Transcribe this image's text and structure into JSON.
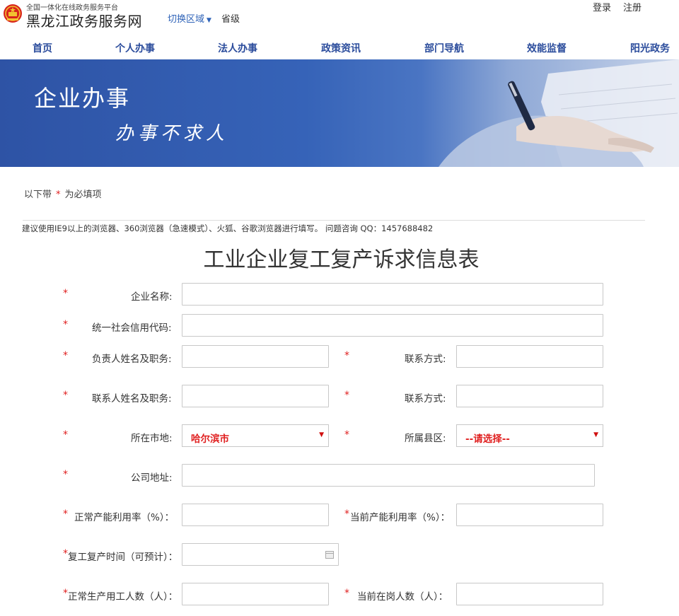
{
  "header": {
    "site_subtitle": "全国一体化在线政务服务平台",
    "site_title": "黑龙江政务服务网",
    "region_switch": "切换区域",
    "region_current": "省级",
    "login": "登录",
    "register": "注册"
  },
  "nav": {
    "items": [
      "首页",
      "个人办事",
      "法人办事",
      "政策资讯",
      "部门导航",
      "效能监督",
      "阳光政务"
    ]
  },
  "banner": {
    "title": "企业办事",
    "slogan": "办事不求人"
  },
  "notice": {
    "required_prefix": "以下带",
    "required_star": "*",
    "required_suffix": "为必填项",
    "browser_tip": "建议使用IE9以上的浏览器、360浏览器（急速模式）、火狐、谷歌浏览器进行填写。 问题咨询 QQ：1457688482"
  },
  "form": {
    "title": "工业企业复工复产诉求信息表",
    "required_mark": "*",
    "fields": {
      "company_name": "企业名称:",
      "credit_code": "统一社会信用代码:",
      "leader_name": "负责人姓名及职务:",
      "leader_contact": "联系方式:",
      "contact_name": "联系人姓名及职务:",
      "contact_phone": "联系方式:",
      "city": "所在市地:",
      "district": "所属县区:",
      "address": "公司地址:",
      "normal_capacity": "正常产能利用率（%）：",
      "current_capacity": "当前产能利用率（%）：",
      "resume_time": "复工复产时间（可预计）：",
      "normal_workers": "正常生产用工人数（人）：",
      "current_workers": "当前在岗人数（人）："
    },
    "city_value": "哈尔滨市",
    "district_value": "--请选择--"
  },
  "colors": {
    "nav_text": "#2b4c9c",
    "banner_blue": "#2e53a5",
    "required_red": "#e02020"
  }
}
